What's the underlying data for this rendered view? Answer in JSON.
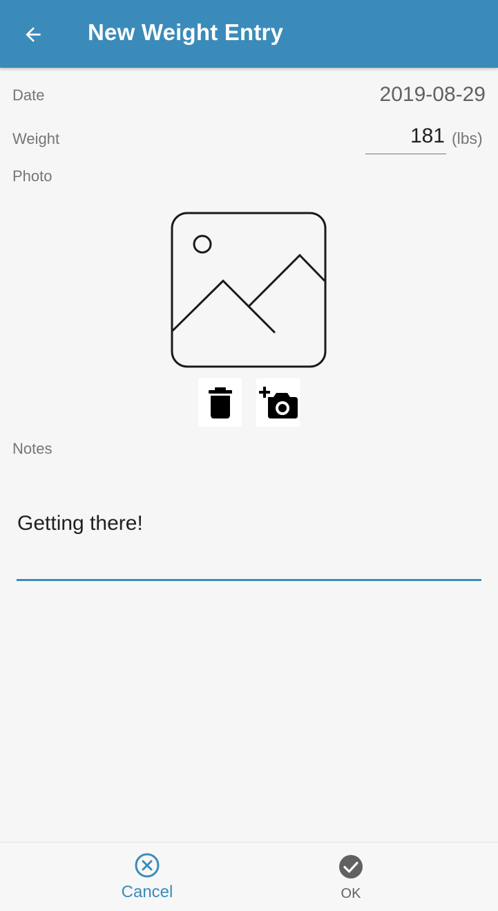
{
  "app_bar": {
    "title": "New Weight Entry",
    "back_icon": "arrow-back-icon",
    "color": "#3b8bba"
  },
  "form": {
    "date": {
      "label": "Date",
      "value": "2019-08-29"
    },
    "weight": {
      "label": "Weight",
      "value": "181",
      "unit": "(lbs)"
    },
    "photo": {
      "label": "Photo",
      "placeholder_icon": "image-placeholder-icon",
      "delete_icon": "trash-icon",
      "add_photo_icon": "add-camera-icon"
    },
    "notes": {
      "label": "Notes",
      "value": "Getting there!"
    }
  },
  "bottom_bar": {
    "cancel": {
      "label": "Cancel",
      "icon": "cancel-circle-icon",
      "color": "#3b8bba"
    },
    "ok": {
      "label": "OK",
      "icon": "check-circle-icon",
      "color": "#616161"
    }
  }
}
